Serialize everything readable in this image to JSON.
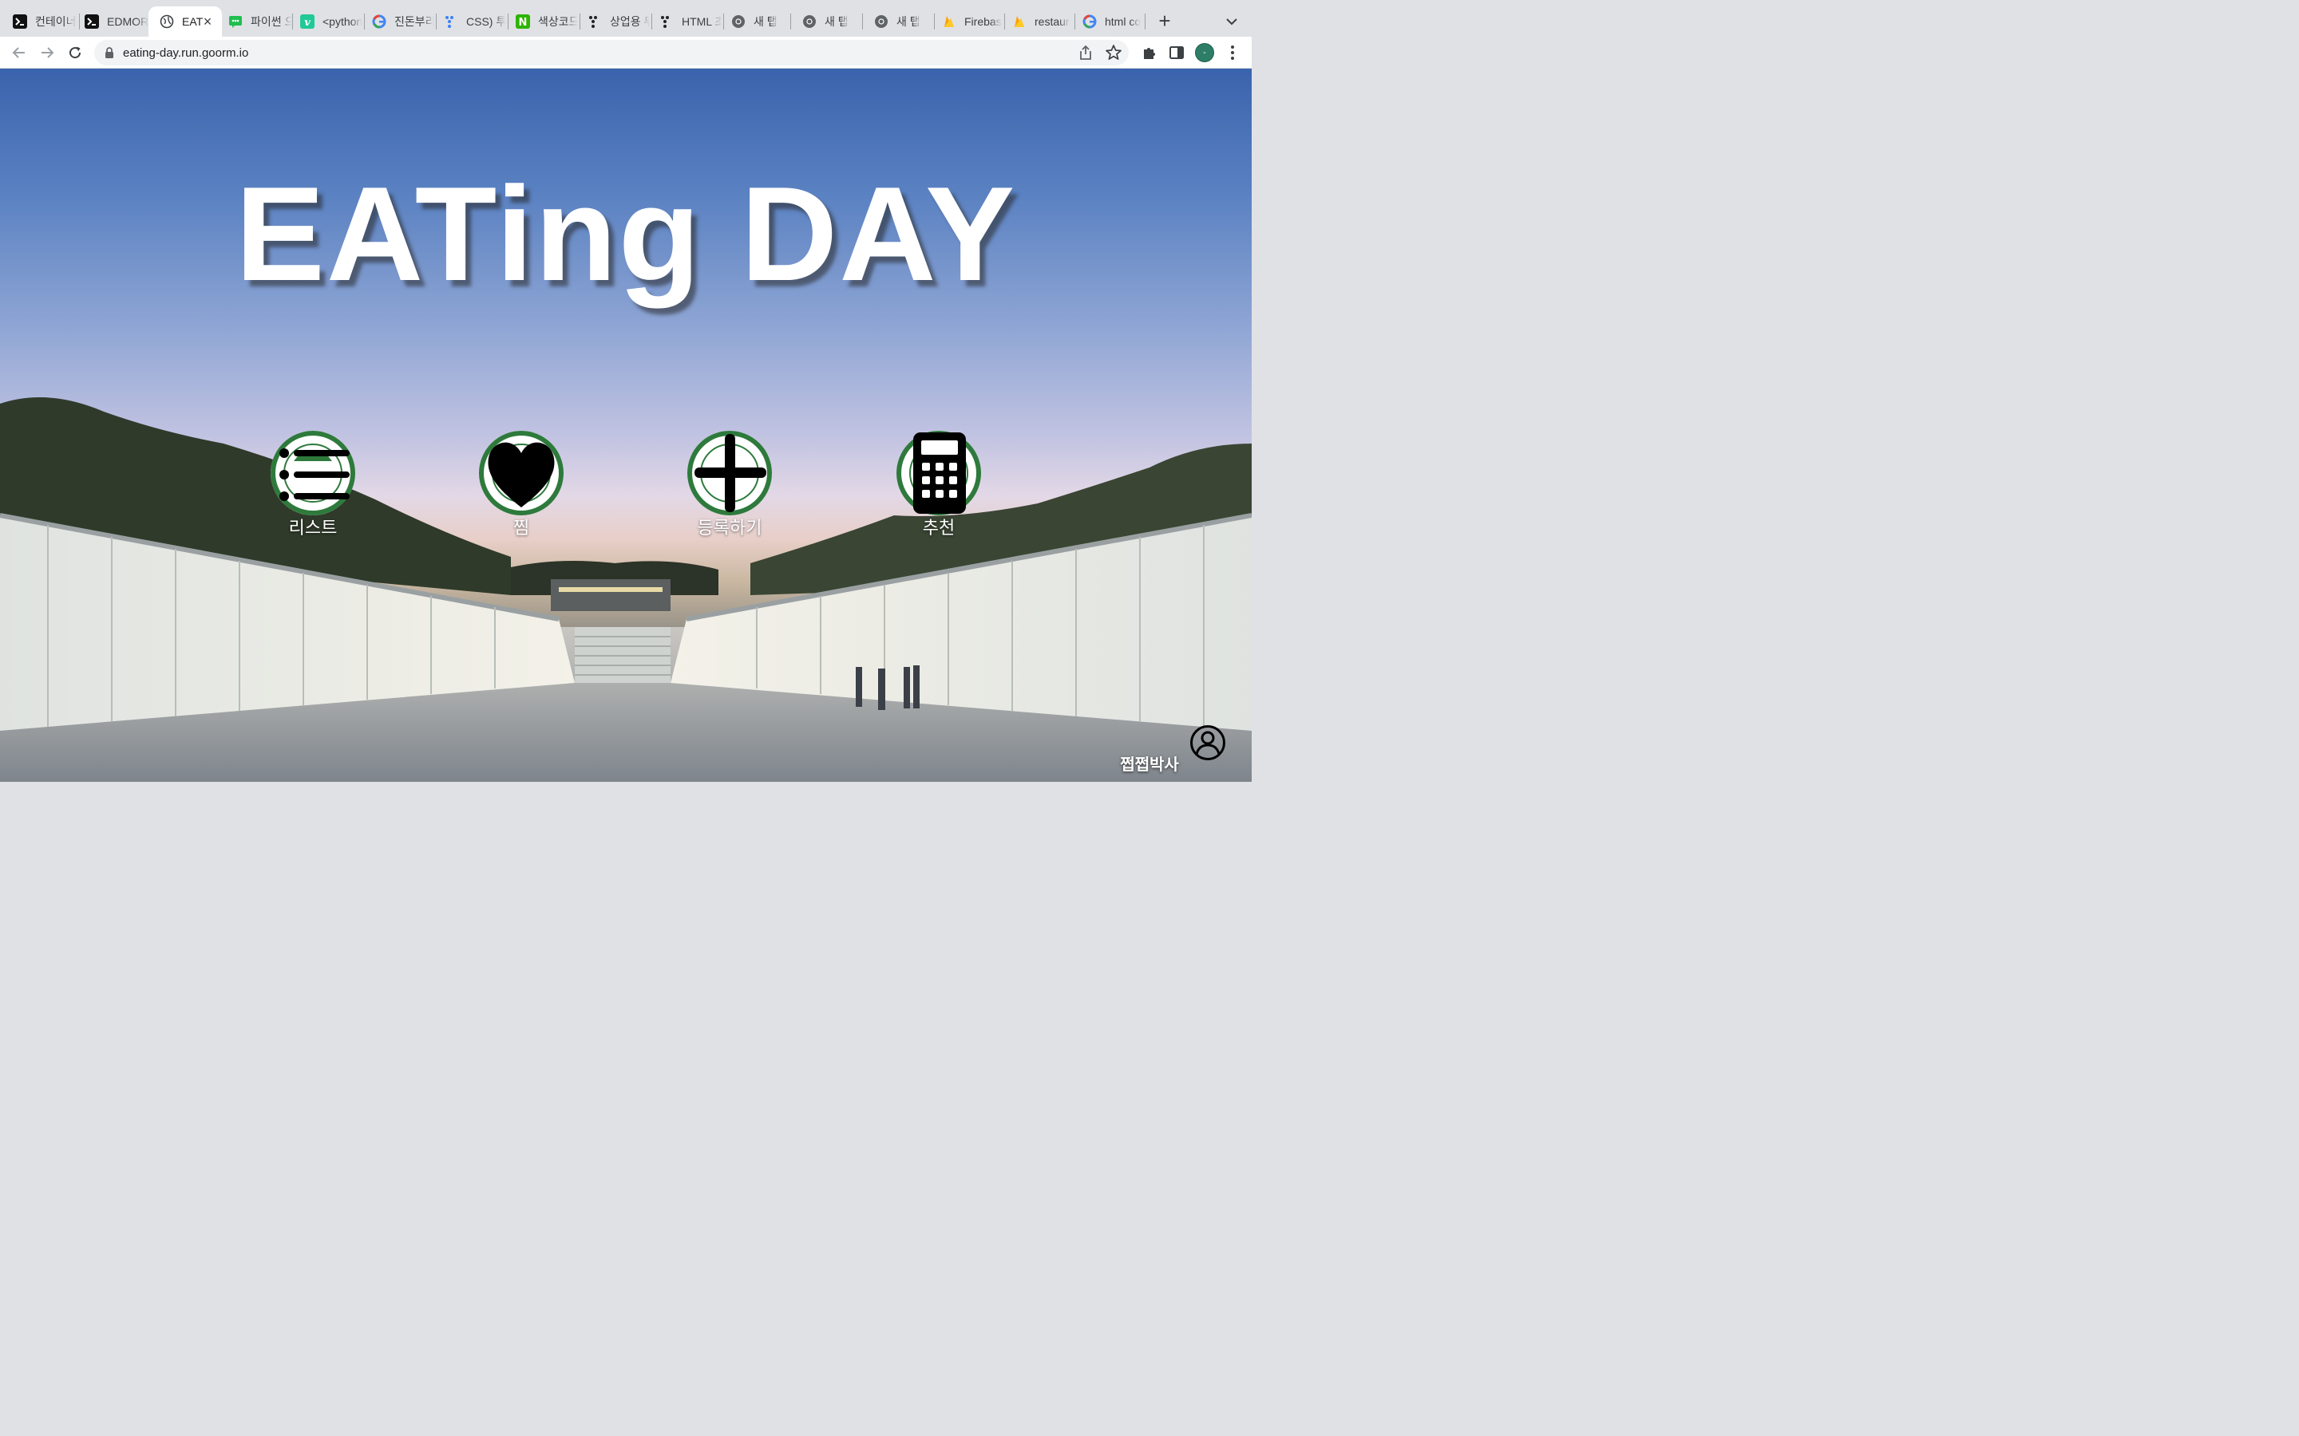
{
  "browser": {
    "tabs": [
      {
        "title": "컨테이너",
        "icon": "terminal-icon",
        "active": false
      },
      {
        "title": "EDMOR",
        "icon": "terminal-icon",
        "active": false
      },
      {
        "title": "EAT",
        "icon": "globe-icon",
        "active": true
      },
      {
        "title": "파이썬 으",
        "icon": "chat-icon",
        "active": false
      },
      {
        "title": "<python",
        "icon": "v-icon",
        "active": false
      },
      {
        "title": "진돈부리",
        "icon": "google-icon",
        "active": false
      },
      {
        "title": "CSS) 투",
        "icon": "dots-icon",
        "active": false
      },
      {
        "title": "색상코드",
        "icon": "n-icon",
        "active": false
      },
      {
        "title": "상업용 두",
        "icon": "dots-icon",
        "active": false
      },
      {
        "title": "HTML 초",
        "icon": "dots-icon",
        "active": false
      },
      {
        "title": "새 탭",
        "icon": "chrome-icon",
        "active": false
      },
      {
        "title": "새 탭",
        "icon": "chrome-icon",
        "active": false
      },
      {
        "title": "새 탭",
        "icon": "chrome-icon",
        "active": false
      },
      {
        "title": "Firebas",
        "icon": "firebase-icon",
        "active": false
      },
      {
        "title": "restaur",
        "icon": "firebase-icon",
        "active": false
      },
      {
        "title": "html co",
        "icon": "google-icon",
        "active": false
      }
    ],
    "url": "eating-day.run.goorm.io",
    "profile_initial": "-",
    "accent": "#2e7d66"
  },
  "page": {
    "title": "EATing DAY",
    "menu": [
      {
        "label": "리스트",
        "icon": "list-icon"
      },
      {
        "label": "찜",
        "icon": "heart-icon"
      },
      {
        "label": "등록하기",
        "icon": "plus-icon"
      },
      {
        "label": "추천",
        "icon": "calculator-icon"
      }
    ],
    "user": {
      "name": "쩝쩝박사",
      "icon": "user-circle-icon"
    },
    "colors": {
      "emblem_green": "#2e7a3c",
      "title": "#ffffff"
    }
  }
}
